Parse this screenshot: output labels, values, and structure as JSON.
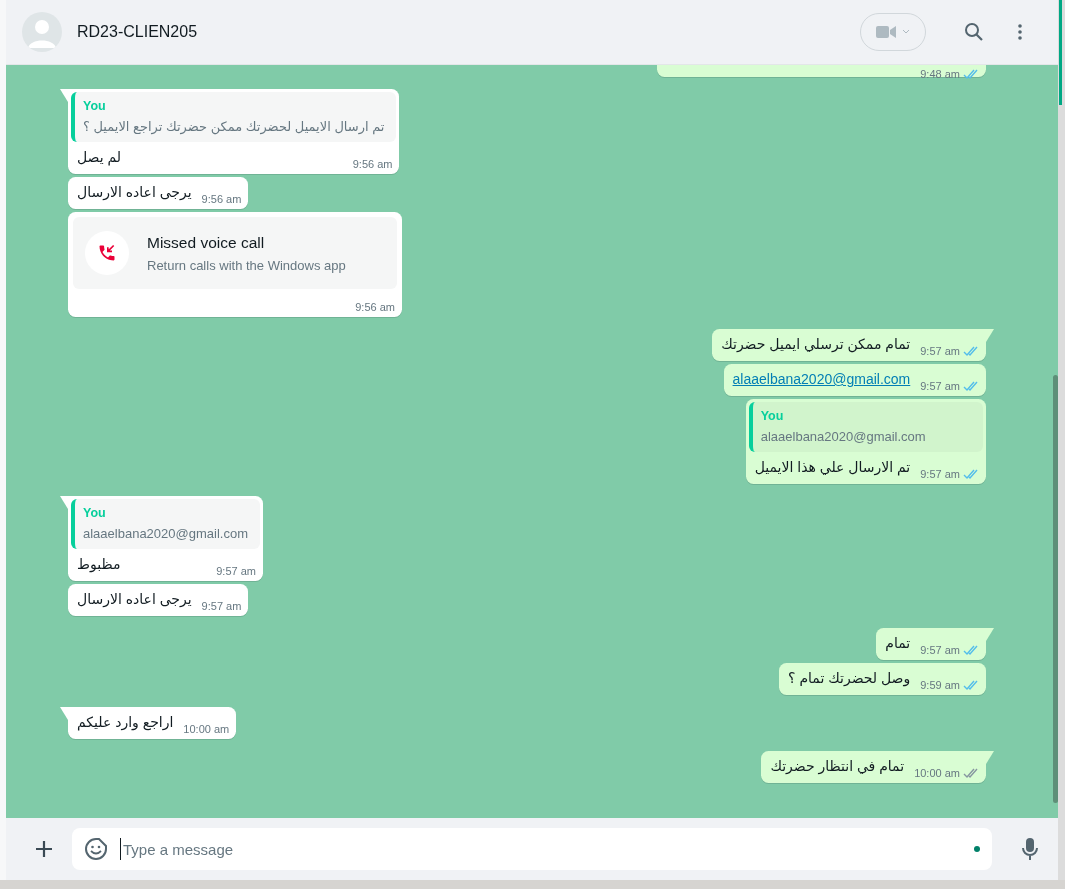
{
  "header": {
    "contact_name": "RD23-CLIEN205"
  },
  "messages": [
    {
      "kind": "cut",
      "outgoing": true,
      "time": "9:48 am",
      "read": true
    },
    {
      "kind": "text",
      "outgoing": false,
      "tail": true,
      "quote": {
        "author": "You",
        "text": "تم ارسال الايميل لحضرتك ممكن حضرتك تراجع الايميل ؟"
      },
      "text": "لم يصل",
      "time": "9:56 am"
    },
    {
      "kind": "text",
      "outgoing": false,
      "tail": false,
      "text": "يرجى اعاده الارسال",
      "time": "9:56 am"
    },
    {
      "kind": "call",
      "outgoing": false,
      "tail": false,
      "title": "Missed voice call",
      "subtitle": "Return calls with the Windows app",
      "time": "9:56 am"
    },
    {
      "kind": "text",
      "outgoing": true,
      "tail": true,
      "text": "تمام ممكن ترسلي ايميل حضرتك",
      "time": "9:57 am",
      "read": true
    },
    {
      "kind": "link",
      "outgoing": true,
      "tail": false,
      "text": "alaaelbana2020@gmail.com",
      "time": "9:57 am",
      "read": true
    },
    {
      "kind": "text",
      "outgoing": true,
      "tail": false,
      "quote": {
        "author": "You",
        "text": "alaaelbana2020@gmail.com"
      },
      "text": "تم الارسال علي هذا الايميل",
      "time": "9:57 am",
      "read": true
    },
    {
      "kind": "text",
      "outgoing": false,
      "tail": true,
      "quote": {
        "author": "You",
        "text": "alaaelbana2020@gmail.com"
      },
      "text": "مظبوط",
      "time": "9:57 am"
    },
    {
      "kind": "text",
      "outgoing": false,
      "tail": false,
      "text": "يرجى اعاده الارسال",
      "time": "9:57 am"
    },
    {
      "kind": "text",
      "outgoing": true,
      "tail": true,
      "text": "تمام",
      "time": "9:57 am",
      "read": true
    },
    {
      "kind": "text",
      "outgoing": true,
      "tail": false,
      "text": "وصل لحضرتك تمام ؟",
      "time": "9:59 am",
      "read": true
    },
    {
      "kind": "text",
      "outgoing": false,
      "tail": true,
      "text": "اراجع وارد عليكم",
      "time": "10:00 am"
    },
    {
      "kind": "text",
      "outgoing": true,
      "tail": true,
      "text": "تمام في انتظار حضرتك",
      "time": "10:00 am",
      "read": false
    }
  ],
  "composer": {
    "placeholder": "Type a message"
  }
}
